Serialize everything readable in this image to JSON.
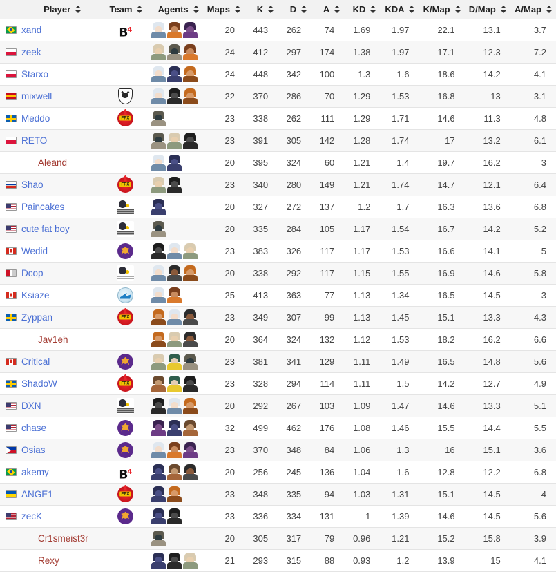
{
  "table": {
    "columns": [
      {
        "key": "player",
        "label": "Player",
        "sortable": true
      },
      {
        "key": "team",
        "label": "Team",
        "sortable": true
      },
      {
        "key": "agents",
        "label": "Agents",
        "sortable": true
      },
      {
        "key": "maps",
        "label": "Maps",
        "sortable": true
      },
      {
        "key": "k",
        "label": "K",
        "sortable": true
      },
      {
        "key": "d",
        "label": "D",
        "sortable": true
      },
      {
        "key": "a",
        "label": "A",
        "sortable": true
      },
      {
        "key": "kd",
        "label": "KD",
        "sortable": true
      },
      {
        "key": "kda",
        "label": "KDA",
        "sortable": true
      },
      {
        "key": "kmap",
        "label": "K/Map",
        "sortable": true
      },
      {
        "key": "dmap",
        "label": "D/Map",
        "sortable": true
      },
      {
        "key": "amap",
        "label": "A/Map",
        "sortable": true
      }
    ],
    "rows": [
      {
        "player": "xand",
        "flag": "br",
        "team": "b4",
        "agents": [
          "jett",
          "reyna",
          "astra"
        ],
        "maps": "20",
        "k": "443",
        "d": "262",
        "a": "74",
        "kd": "1.69",
        "kda": "1.97",
        "kmap": "22.1",
        "dmap": "13.1",
        "amap": "3.7"
      },
      {
        "player": "zeek",
        "flag": "pl",
        "team": null,
        "agents": [
          "sova",
          "cypher",
          "reyna"
        ],
        "maps": "24",
        "k": "412",
        "d": "297",
        "a": "174",
        "kd": "1.38",
        "kda": "1.97",
        "kmap": "17.1",
        "dmap": "12.3",
        "amap": "7.2"
      },
      {
        "player": "Starxo",
        "flag": "pl",
        "team": null,
        "agents": [
          "jett",
          "omen",
          "breach"
        ],
        "maps": "24",
        "k": "448",
        "d": "342",
        "a": "100",
        "kd": "1.3",
        "kda": "1.6",
        "kmap": "18.6",
        "dmap": "14.2",
        "amap": "4.1"
      },
      {
        "player": "mixwell",
        "flag": "es",
        "team": "g2",
        "agents": [
          "jett",
          "viper",
          "breach"
        ],
        "maps": "22",
        "k": "370",
        "d": "286",
        "a": "70",
        "kd": "1.29",
        "kda": "1.53",
        "kmap": "16.8",
        "dmap": "13",
        "amap": "3.1"
      },
      {
        "player": "Meddo",
        "flag": "se",
        "team": "fpx",
        "agents": [
          "cypher"
        ],
        "maps": "23",
        "k": "338",
        "d": "262",
        "a": "111",
        "kd": "1.29",
        "kda": "1.71",
        "kmap": "14.6",
        "dmap": "11.3",
        "amap": "4.8"
      },
      {
        "player": "RETO",
        "flag": "pl",
        "team": null,
        "agents": [
          "cypher",
          "sova",
          "viper"
        ],
        "maps": "23",
        "k": "391",
        "d": "305",
        "a": "142",
        "kd": "1.28",
        "kda": "1.74",
        "kmap": "17",
        "dmap": "13.2",
        "amap": "6.1"
      },
      {
        "player": "Aleand",
        "flag": null,
        "team": null,
        "agents": [
          "jett",
          "omen"
        ],
        "maps": "20",
        "k": "395",
        "d": "324",
        "a": "60",
        "kd": "1.21",
        "kda": "1.4",
        "kmap": "19.7",
        "dmap": "16.2",
        "amap": "3"
      },
      {
        "player": "Shao",
        "flag": "ru",
        "team": "fpx",
        "agents": [
          "sova",
          "viper"
        ],
        "maps": "23",
        "k": "340",
        "d": "280",
        "a": "149",
        "kd": "1.21",
        "kda": "1.74",
        "kmap": "14.7",
        "dmap": "12.1",
        "amap": "6.4"
      },
      {
        "player": "Paincakes",
        "flag": "us",
        "team": "cn",
        "agents": [
          "omen"
        ],
        "maps": "20",
        "k": "327",
        "d": "272",
        "a": "137",
        "kd": "1.2",
        "kda": "1.7",
        "kmap": "16.3",
        "dmap": "13.6",
        "amap": "6.8"
      },
      {
        "player": "cute fat boy",
        "flag": "us",
        "team": "cn",
        "agents": [
          "cypher"
        ],
        "maps": "20",
        "k": "335",
        "d": "284",
        "a": "105",
        "kd": "1.17",
        "kda": "1.54",
        "kmap": "16.7",
        "dmap": "14.2",
        "amap": "5.2"
      },
      {
        "player": "Wedid",
        "flag": "ca",
        "team": "nip",
        "agents": [
          "viper",
          "jett",
          "sova"
        ],
        "maps": "23",
        "k": "383",
        "d": "326",
        "a": "117",
        "kd": "1.17",
        "kda": "1.53",
        "kmap": "16.6",
        "dmap": "14.1",
        "amap": "5"
      },
      {
        "player": "Dcop",
        "flag": "mx",
        "team": "cn",
        "agents": [
          "jett",
          "raze",
          "breach"
        ],
        "maps": "20",
        "k": "338",
        "d": "292",
        "a": "117",
        "kd": "1.15",
        "kda": "1.55",
        "kmap": "16.9",
        "dmap": "14.6",
        "amap": "5.8"
      },
      {
        "player": "Ksiaze",
        "flag": "ca",
        "team": "blue",
        "agents": [
          "jett",
          "reyna"
        ],
        "maps": "25",
        "k": "413",
        "d": "363",
        "a": "77",
        "kd": "1.13",
        "kda": "1.34",
        "kmap": "16.5",
        "dmap": "14.5",
        "amap": "3"
      },
      {
        "player": "Zyppan",
        "flag": "se",
        "team": "fpx",
        "agents": [
          "breach",
          "jett",
          "raze"
        ],
        "maps": "23",
        "k": "349",
        "d": "307",
        "a": "99",
        "kd": "1.13",
        "kda": "1.45",
        "kmap": "15.1",
        "dmap": "13.3",
        "amap": "4.3"
      },
      {
        "player": "Jav1eh",
        "flag": null,
        "team": null,
        "agents": [
          "breach",
          "sova",
          "raze"
        ],
        "maps": "20",
        "k": "364",
        "d": "324",
        "a": "132",
        "kd": "1.12",
        "kda": "1.53",
        "kmap": "18.2",
        "dmap": "16.2",
        "amap": "6.6"
      },
      {
        "player": "Critical",
        "flag": "ca",
        "team": "nip",
        "agents": [
          "sova",
          "sage",
          "cypher"
        ],
        "maps": "23",
        "k": "381",
        "d": "341",
        "a": "129",
        "kd": "1.11",
        "kda": "1.49",
        "kmap": "16.5",
        "dmap": "14.8",
        "amap": "5.6"
      },
      {
        "player": "ShadoW",
        "flag": "se",
        "team": "fpx",
        "agents": [
          "brim",
          "sage",
          "viper"
        ],
        "maps": "23",
        "k": "328",
        "d": "294",
        "a": "114",
        "kd": "1.11",
        "kda": "1.5",
        "kmap": "14.2",
        "dmap": "12.7",
        "amap": "4.9"
      },
      {
        "player": "DXN",
        "flag": "us",
        "team": "cn",
        "agents": [
          "viper",
          "jett",
          "breach"
        ],
        "maps": "20",
        "k": "292",
        "d": "267",
        "a": "103",
        "kd": "1.09",
        "kda": "1.47",
        "kmap": "14.6",
        "dmap": "13.3",
        "amap": "5.1"
      },
      {
        "player": "chase",
        "flag": "us",
        "team": "nip",
        "agents": [
          "astra",
          "omen",
          "brim"
        ],
        "maps": "32",
        "k": "499",
        "d": "462",
        "a": "176",
        "kd": "1.08",
        "kda": "1.46",
        "kmap": "15.5",
        "dmap": "14.4",
        "amap": "5.5"
      },
      {
        "player": "Osias",
        "flag": "ph",
        "team": "nip",
        "agents": [
          "jett",
          "reyna",
          "astra"
        ],
        "maps": "23",
        "k": "370",
        "d": "348",
        "a": "84",
        "kd": "1.06",
        "kda": "1.3",
        "kmap": "16",
        "dmap": "15.1",
        "amap": "3.6"
      },
      {
        "player": "akemy",
        "flag": "br",
        "team": "b4",
        "agents": [
          "omen",
          "brim",
          "raze"
        ],
        "maps": "20",
        "k": "256",
        "d": "245",
        "a": "136",
        "kd": "1.04",
        "kda": "1.6",
        "kmap": "12.8",
        "dmap": "12.2",
        "amap": "6.8"
      },
      {
        "player": "ANGE1",
        "flag": "ua",
        "team": "fpx",
        "agents": [
          "omen",
          "breach"
        ],
        "maps": "23",
        "k": "348",
        "d": "335",
        "a": "94",
        "kd": "1.03",
        "kda": "1.31",
        "kmap": "15.1",
        "dmap": "14.5",
        "amap": "4"
      },
      {
        "player": "zecK",
        "flag": "us",
        "team": "nip",
        "agents": [
          "omen",
          "viper"
        ],
        "maps": "23",
        "k": "336",
        "d": "334",
        "a": "131",
        "kd": "1",
        "kda": "1.39",
        "kmap": "14.6",
        "dmap": "14.5",
        "amap": "5.6"
      },
      {
        "player": "Cr1smeist3r",
        "flag": null,
        "team": null,
        "agents": [
          "cypher"
        ],
        "maps": "20",
        "k": "305",
        "d": "317",
        "a": "79",
        "kd": "0.96",
        "kda": "1.21",
        "kmap": "15.2",
        "dmap": "15.8",
        "amap": "3.9"
      },
      {
        "player": "Rexy",
        "flag": null,
        "team": null,
        "agents": [
          "omen",
          "viper",
          "sova"
        ],
        "maps": "21",
        "k": "293",
        "d": "315",
        "a": "88",
        "kd": "0.93",
        "kda": "1.2",
        "kmap": "13.9",
        "dmap": "15",
        "amap": "4.1"
      }
    ]
  },
  "colors": {
    "link": "#4a6fd4",
    "no_team_name": "#a33b32",
    "header_bg": "#f2f2f2",
    "row_alt_bg": "#f7f7f7",
    "text": "#444444"
  }
}
